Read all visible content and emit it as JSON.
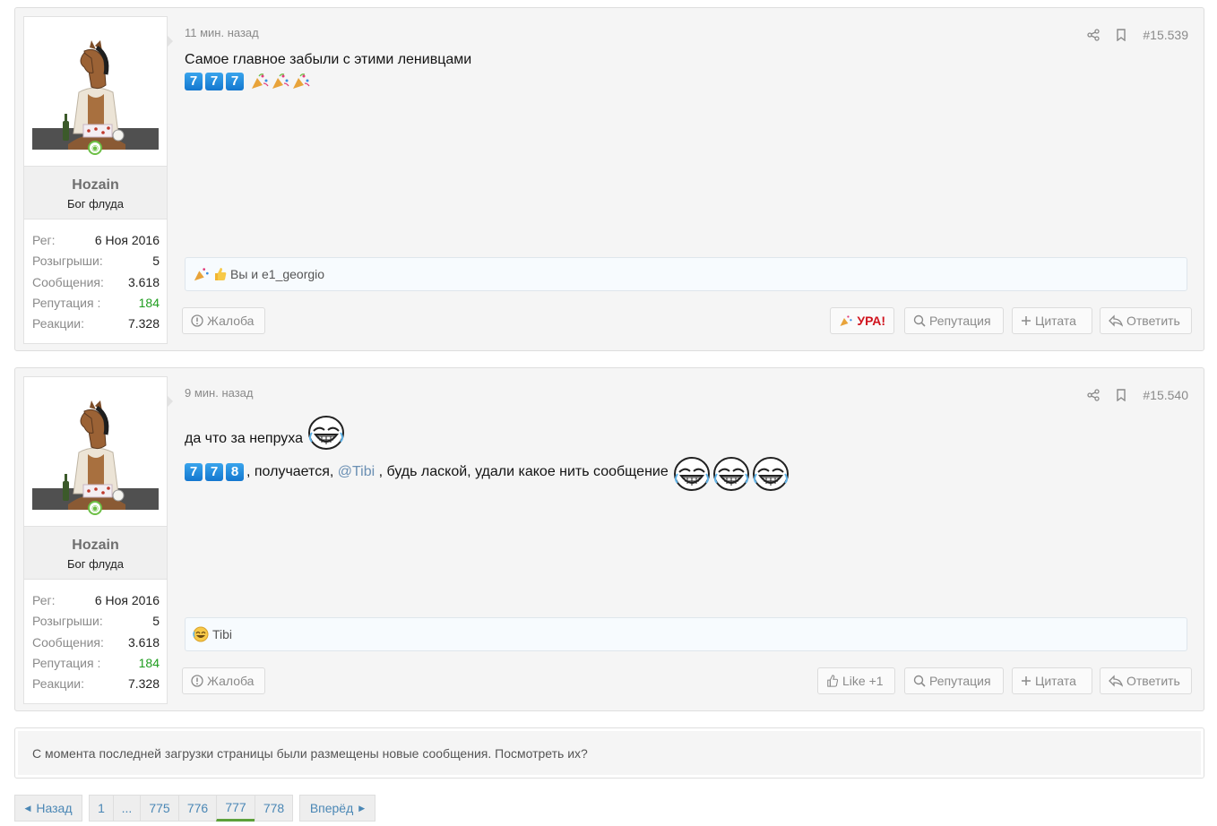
{
  "posts": [
    {
      "time": "11 мин. назад",
      "number": "#15.539",
      "user": {
        "name": "Hozain",
        "title": "Бог флуда",
        "stats": [
          {
            "label": "Рег:",
            "value": "6 Ноя 2016"
          },
          {
            "label": "Розыгрыши:",
            "value": "5"
          },
          {
            "label": "Сообщения:",
            "value": "3.618"
          },
          {
            "label": "Репутация :",
            "value": "184"
          },
          {
            "label": "Реакции:",
            "value": "7.328"
          }
        ]
      },
      "text": "Самое главное забыли с этими ленивцами",
      "digits": [
        "7",
        "7",
        "7"
      ],
      "reactions": "Вы и e1_georgio",
      "buttons": {
        "report": "Жалоба",
        "reaction": "УРА!",
        "reputation": "Репутация",
        "quote": "Цитата",
        "reply": "Ответить"
      }
    },
    {
      "time": "9 мин. назад",
      "number": "#15.540",
      "user": {
        "name": "Hozain",
        "title": "Бог флуда",
        "stats": [
          {
            "label": "Рег:",
            "value": "6 Ноя 2016"
          },
          {
            "label": "Розыгрыши:",
            "value": "5"
          },
          {
            "label": "Сообщения:",
            "value": "3.618"
          },
          {
            "label": "Репутация :",
            "value": "184"
          },
          {
            "label": "Реакции:",
            "value": "7.328"
          }
        ]
      },
      "text_line1": "да что за непруха",
      "digits": [
        "7",
        "7",
        "8"
      ],
      "text_line2_before": ", получается, ",
      "mention": "@Tibi",
      "text_line2_after": " , будь лаской, удали какое нить сообщение",
      "reactions": "Tibi",
      "buttons": {
        "report": "Жалоба",
        "reaction": "Like +1",
        "reputation": "Репутация",
        "quote": "Цитата",
        "reply": "Ответить"
      }
    }
  ],
  "notice": "С момента последней загрузки страницы были размещены новые сообщения. Посмотреть их?",
  "pagination": {
    "prev": "Назад",
    "next": "Вперёд",
    "pages": [
      "1",
      "...",
      "775",
      "776",
      "777",
      "778"
    ],
    "current": "777"
  },
  "colors": {
    "accent_green": "#5da03a",
    "reputation_green": "#1f9d1f",
    "link_blue": "#4a87b5",
    "ura_red": "#d0141e"
  }
}
